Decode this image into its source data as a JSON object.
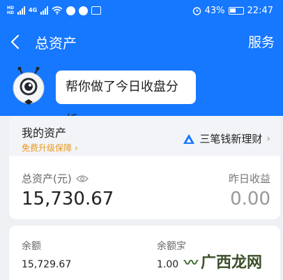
{
  "status_bar": {
    "left_label_1": "HD",
    "left_label_2": "HD",
    "signal_label": "4G",
    "battery_percent": "43%",
    "time": "22:47",
    "icons": [
      "signal-icon",
      "wifi-icon",
      "message-icon",
      "alarm-icon",
      "battery-icon"
    ]
  },
  "nav": {
    "back_icon": "back-chevron-icon",
    "title": "总资产",
    "right_action": "服务"
  },
  "assistant": {
    "avatar_icon": "robot-avatar-icon",
    "bubble_text": "帮你做了今日收盘分析"
  },
  "asset_card": {
    "heading": "我的资产",
    "upgrade_link": "免费升级保障",
    "partner_icon": "triangle-logo-icon",
    "partner_name": "三笔钱新理财",
    "total_label": "总资产(元)",
    "total_value": "15,730.67",
    "yesterday_label": "昨日收益",
    "yesterday_value": "0.00",
    "accent_color": "#1677ff",
    "upgrade_color": "#e89a1f"
  },
  "breakdown": {
    "balance_label": "余额",
    "balance_value": "15,729.67",
    "yeb_label": "余额宝",
    "yeb_value": "1.00"
  },
  "watermark": {
    "text": "广西龙网"
  }
}
